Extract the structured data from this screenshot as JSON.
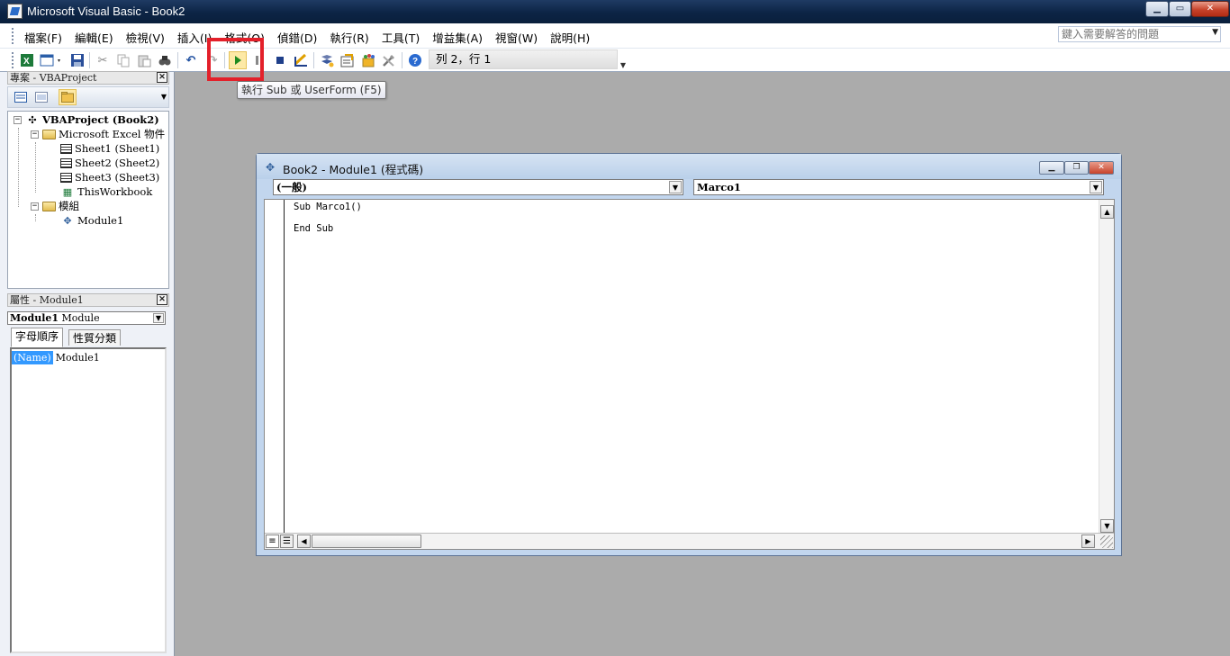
{
  "window": {
    "title": "Microsoft Visual Basic - Book2",
    "min": "▁",
    "max": "▭",
    "close": "✕"
  },
  "menu": {
    "items": [
      {
        "label": "檔案(F)"
      },
      {
        "label": "編輯(E)"
      },
      {
        "label": "檢視(V)"
      },
      {
        "label": "插入(I)"
      },
      {
        "label": "格式(O)"
      },
      {
        "label": "偵錯(D)"
      },
      {
        "label": "執行(R)"
      },
      {
        "label": "工具(T)"
      },
      {
        "label": "增益集(A)"
      },
      {
        "label": "視窗(W)"
      },
      {
        "label": "說明(H)"
      }
    ],
    "help_placeholder": "鍵入需要解答的問題"
  },
  "toolbar": {
    "icons": [
      "excel-icon",
      "insert-userform-icon",
      "save-icon",
      "cut-icon",
      "copy-icon",
      "paste-icon",
      "find-icon",
      "undo-icon",
      "redo-icon",
      "run-icon",
      "break-icon",
      "reset-icon",
      "design-mode-icon",
      "project-explorer-icon",
      "properties-window-icon",
      "object-browser-icon",
      "toolbox-icon",
      "help-icon"
    ],
    "cursor_position": "列 2，行 1",
    "tooltip": "執行 Sub 或 UserForm (F5)"
  },
  "project": {
    "header": "專案 - VBAProject",
    "tree": [
      {
        "label": "VBAProject (Book2)",
        "bold": true
      },
      {
        "label": "Microsoft Excel 物件"
      },
      {
        "label": "Sheet1 (Sheet1)"
      },
      {
        "label": "Sheet2 (Sheet2)"
      },
      {
        "label": "Sheet3 (Sheet3)"
      },
      {
        "label": "ThisWorkbook"
      },
      {
        "label": "模組"
      },
      {
        "label": "Module1"
      }
    ]
  },
  "properties": {
    "header": "屬性 - Module1",
    "object_name": "Module1",
    "object_type": "Module",
    "tabs": [
      "字母順序",
      "性質分類"
    ],
    "rows": [
      {
        "name": "(Name)",
        "value": "Module1"
      }
    ]
  },
  "code_window": {
    "title": "Book2 - Module1 (程式碼)",
    "object_combo": "(一般)",
    "procedure_combo": "Marco1",
    "lines": [
      "Sub Marco1()",
      "End Sub"
    ]
  }
}
